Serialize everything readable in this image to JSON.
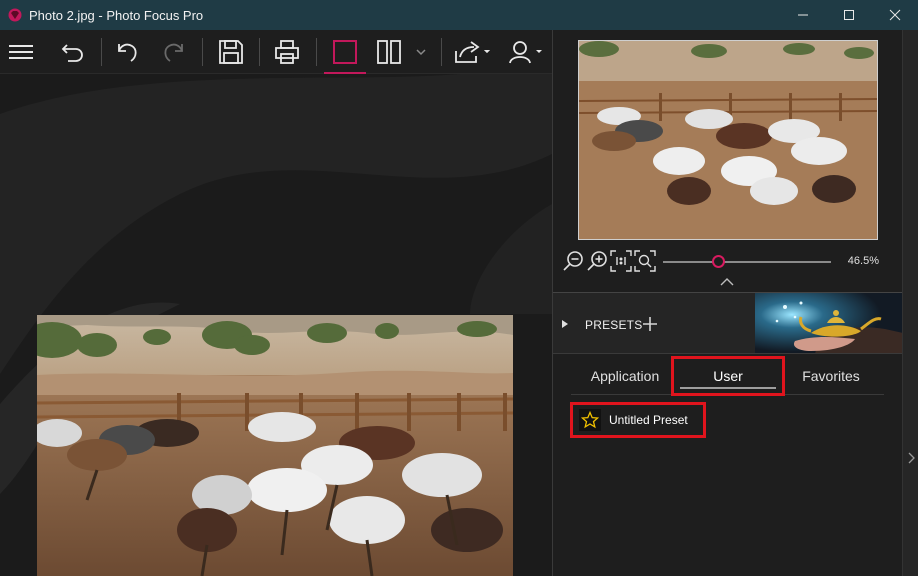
{
  "window": {
    "title": "Photo 2.jpg - Photo Focus Pro",
    "icon": "app-logo-icon"
  },
  "toolbar": {
    "items": [
      "menu-icon",
      "undo-history-icon",
      "undo-icon",
      "redo-icon",
      "save-icon",
      "print-icon",
      "single-view-icon",
      "compare-view-icon",
      "share-icon",
      "account-icon"
    ],
    "active": "single-view"
  },
  "navigator": {
    "zoom_value": "46.5%",
    "zoom_level": 0.33
  },
  "presets": {
    "header_label": "PRESETS",
    "tabs": [
      {
        "label": "Application"
      },
      {
        "label": "User"
      },
      {
        "label": "Favorites"
      }
    ],
    "active_tab": "User",
    "items": [
      {
        "name": "Untitled Preset"
      }
    ]
  },
  "colors": {
    "titlebar": "#1f3b45",
    "accent": "#c2185b",
    "highlight": "#e0141d",
    "star": "#f2c200"
  }
}
